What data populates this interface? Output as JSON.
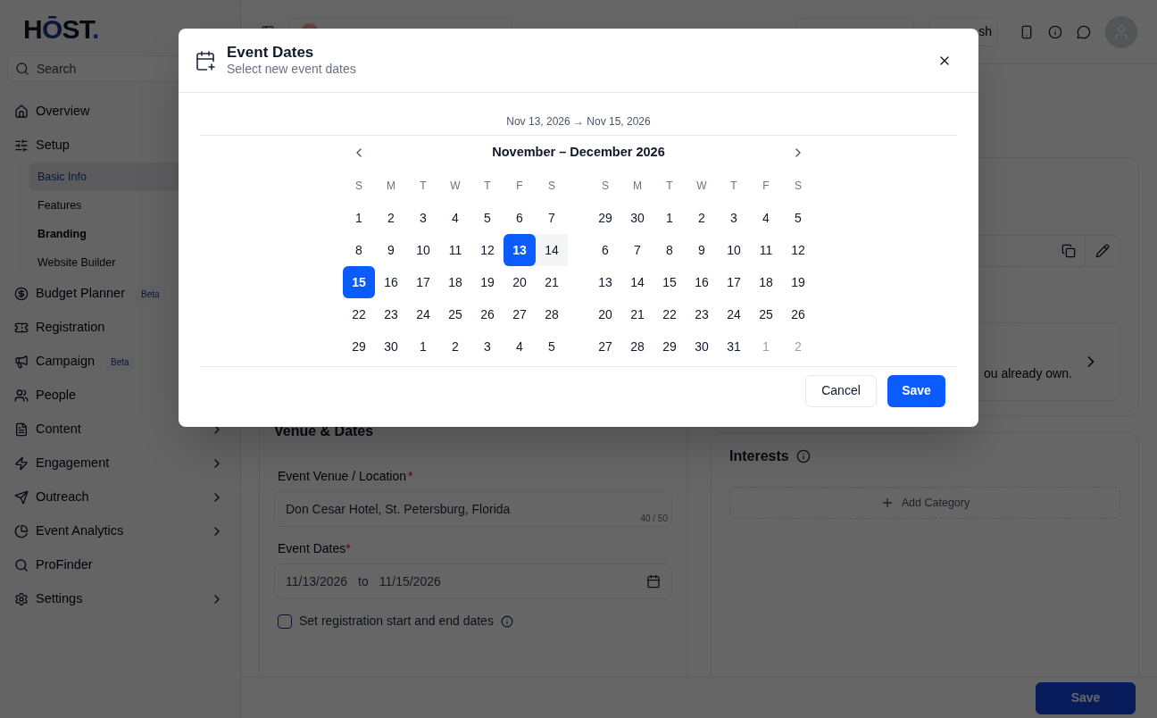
{
  "sidebar": {
    "logo": {
      "text": "H",
      "accent": "Ō",
      "rest": "ST",
      "dot": "."
    },
    "search": {
      "placeholder": "Search"
    },
    "items": [
      {
        "label": "Overview"
      },
      {
        "label": "Setup",
        "children": [
          {
            "label": "Basic Info",
            "selected": true,
            "bold": false
          },
          {
            "label": "Features",
            "selected": false,
            "bold": false
          },
          {
            "label": "Branding",
            "selected": false,
            "bold": true
          },
          {
            "label": "Website Builder",
            "selected": false,
            "bold": false
          }
        ]
      },
      {
        "label": "Budget Planner",
        "badge": "Beta"
      },
      {
        "label": "Registration"
      },
      {
        "label": "Campaign",
        "badge": "Beta"
      },
      {
        "label": "People"
      },
      {
        "label": "Content",
        "chevron": true
      },
      {
        "label": "Engagement",
        "chevron": true
      },
      {
        "label": "Outreach",
        "chevron": true
      },
      {
        "label": "Event Analytics",
        "chevron": true
      },
      {
        "label": "ProFinder",
        "chevron": false
      },
      {
        "label": "Settings",
        "chevron": true
      }
    ]
  },
  "topbar": {
    "publish_label": "sh"
  },
  "background_card": {
    "text": "ou already own."
  },
  "venue": {
    "title": "Venue & Dates",
    "location_label": "Event Venue / Location",
    "required_mark": "*",
    "location_value": "Don Cesar Hotel, St. Petersburg, Florida",
    "counter": "40 / 50",
    "dates_label": "Event Dates",
    "start": "11/13/2026",
    "to": "to",
    "end": "11/15/2026",
    "checkbox": {
      "label": "Set registration start and end dates",
      "checked": false
    }
  },
  "interests": {
    "title": "Interests",
    "add": "Add Category"
  },
  "footer": {
    "save": "Save"
  },
  "dialog": {
    "title": "Event Dates",
    "subtitle": "Select new event dates",
    "range": "Nov 13, 2026 → Nov 15, 2026",
    "month_title": "November – December 2026",
    "cancel": "Cancel",
    "save": "Save",
    "months": [
      {
        "weekdays": [
          "S",
          "M",
          "T",
          "W",
          "T",
          "F",
          "S"
        ],
        "weeks": [
          [
            {
              "label": "1",
              "kind": "plain"
            },
            {
              "label": "2",
              "kind": "plain"
            },
            {
              "label": "3",
              "kind": "plain"
            },
            {
              "label": "4",
              "kind": "plain"
            },
            {
              "label": "5",
              "kind": "plain"
            },
            {
              "label": "6",
              "kind": "plain"
            },
            {
              "label": "7",
              "kind": "plain"
            }
          ],
          [
            {
              "label": "8",
              "kind": "plain"
            },
            {
              "label": "9",
              "kind": "plain"
            },
            {
              "label": "10",
              "kind": "plain"
            },
            {
              "label": "11",
              "kind": "plain"
            },
            {
              "label": "12",
              "kind": "plain"
            },
            {
              "label": "13",
              "kind": "start"
            },
            {
              "label": "14",
              "kind": "middle"
            }
          ],
          [
            {
              "label": "15",
              "kind": "end"
            },
            {
              "label": "16",
              "kind": "plain"
            },
            {
              "label": "17",
              "kind": "plain"
            },
            {
              "label": "18",
              "kind": "plain"
            },
            {
              "label": "19",
              "kind": "plain"
            },
            {
              "label": "20",
              "kind": "plain"
            },
            {
              "label": "21",
              "kind": "plain"
            }
          ],
          [
            {
              "label": "22",
              "kind": "plain"
            },
            {
              "label": "23",
              "kind": "plain"
            },
            {
              "label": "24",
              "kind": "plain"
            },
            {
              "label": "25",
              "kind": "plain"
            },
            {
              "label": "26",
              "kind": "plain"
            },
            {
              "label": "27",
              "kind": "plain"
            },
            {
              "label": "28",
              "kind": "plain"
            }
          ],
          [
            {
              "label": "29",
              "kind": "plain"
            },
            {
              "label": "30",
              "kind": "plain"
            },
            {
              "label": "1",
              "kind": "plain"
            },
            {
              "label": "2",
              "kind": "plain"
            },
            {
              "label": "3",
              "kind": "plain"
            },
            {
              "label": "4",
              "kind": "plain"
            },
            {
              "label": "5",
              "kind": "plain"
            }
          ]
        ]
      },
      {
        "weekdays": [
          "S",
          "M",
          "T",
          "W",
          "T",
          "F",
          "S"
        ],
        "weeks": [
          [
            {
              "label": "29",
              "kind": "plain"
            },
            {
              "label": "30",
              "kind": "plain"
            },
            {
              "label": "1",
              "kind": "plain"
            },
            {
              "label": "2",
              "kind": "plain"
            },
            {
              "label": "3",
              "kind": "plain"
            },
            {
              "label": "4",
              "kind": "plain"
            },
            {
              "label": "5",
              "kind": "plain"
            }
          ],
          [
            {
              "label": "6",
              "kind": "plain"
            },
            {
              "label": "7",
              "kind": "plain"
            },
            {
              "label": "8",
              "kind": "plain"
            },
            {
              "label": "9",
              "kind": "plain"
            },
            {
              "label": "10",
              "kind": "plain"
            },
            {
              "label": "11",
              "kind": "plain"
            },
            {
              "label": "12",
              "kind": "plain"
            }
          ],
          [
            {
              "label": "13",
              "kind": "plain"
            },
            {
              "label": "14",
              "kind": "plain"
            },
            {
              "label": "15",
              "kind": "plain"
            },
            {
              "label": "16",
              "kind": "plain"
            },
            {
              "label": "17",
              "kind": "plain"
            },
            {
              "label": "18",
              "kind": "plain"
            },
            {
              "label": "19",
              "kind": "plain"
            }
          ],
          [
            {
              "label": "20",
              "kind": "plain"
            },
            {
              "label": "21",
              "kind": "plain"
            },
            {
              "label": "22",
              "kind": "plain"
            },
            {
              "label": "23",
              "kind": "plain"
            },
            {
              "label": "24",
              "kind": "plain"
            },
            {
              "label": "25",
              "kind": "plain"
            },
            {
              "label": "26",
              "kind": "plain"
            }
          ],
          [
            {
              "label": "27",
              "kind": "plain"
            },
            {
              "label": "28",
              "kind": "plain"
            },
            {
              "label": "29",
              "kind": "plain"
            },
            {
              "label": "30",
              "kind": "plain"
            },
            {
              "label": "31",
              "kind": "plain"
            },
            {
              "label": "1",
              "kind": "muted"
            },
            {
              "label": "2",
              "kind": "muted"
            }
          ]
        ]
      }
    ]
  }
}
